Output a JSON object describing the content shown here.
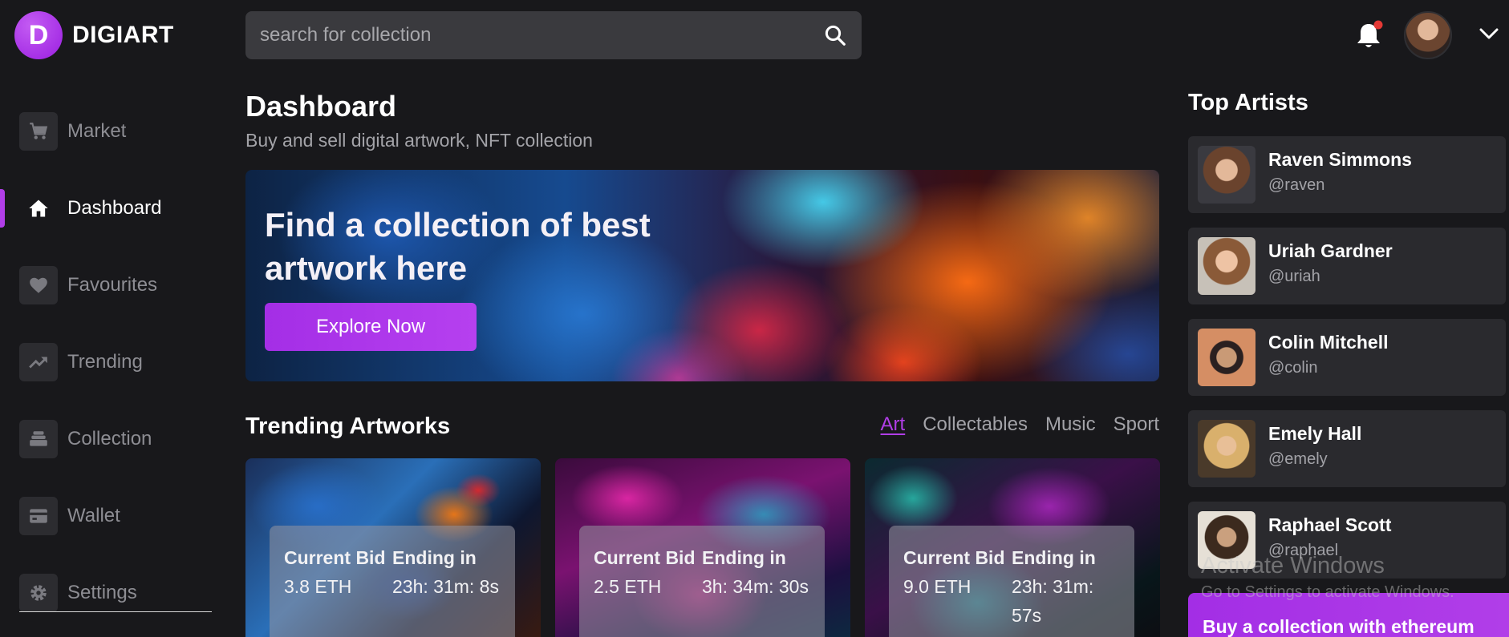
{
  "brand": {
    "logo_letter": "D",
    "name": "DIGIART"
  },
  "header": {
    "search_placeholder": "search for collection",
    "icons": [
      "search-icon",
      "bell-icon",
      "avatar",
      "chevron-down-icon"
    ],
    "notification_dot_color": "#e53935"
  },
  "sidebar": {
    "items": [
      {
        "label": "Market",
        "icon": "cart-icon",
        "active": false
      },
      {
        "label": "Dashboard",
        "icon": "home-icon",
        "active": true
      },
      {
        "label": "Favourites",
        "icon": "heart-icon",
        "active": false
      },
      {
        "label": "Trending",
        "icon": "trending-icon",
        "active": false
      },
      {
        "label": "Collection",
        "icon": "stack-icon",
        "active": false
      },
      {
        "label": "Wallet",
        "icon": "wallet-icon",
        "active": false
      },
      {
        "label": "Settings",
        "icon": "gear-icon",
        "active": false
      }
    ]
  },
  "main": {
    "title": "Dashboard",
    "subtitle": "Buy and sell digital artwork, NFT collection",
    "banner": {
      "title": "Find a collection of best artwork here",
      "button": "Explore Now"
    },
    "trending": {
      "title": "Trending Artworks",
      "filters": [
        "Art",
        "Collectables",
        "Music",
        "Sport"
      ],
      "active_filter": "Art",
      "cards": [
        {
          "bid_label": "Current Bid",
          "bid": "3.8 ETH",
          "ending_label": "Ending in",
          "ending": "23h: 31m: 8s"
        },
        {
          "bid_label": "Current Bid",
          "bid": "2.5 ETH",
          "ending_label": "Ending in",
          "ending": "3h: 34m: 30s"
        },
        {
          "bid_label": "Current Bid",
          "bid": "9.0 ETH",
          "ending_label": "Ending in",
          "ending": "23h: 31m: 57s"
        }
      ]
    }
  },
  "top_artists": {
    "title": "Top Artists",
    "artists": [
      {
        "name": "Raven Simmons",
        "handle": "@raven"
      },
      {
        "name": "Uriah Gardner",
        "handle": "@uriah"
      },
      {
        "name": "Colin Mitchell",
        "handle": "@colin"
      },
      {
        "name": "Emely Hall",
        "handle": "@emely"
      },
      {
        "name": "Raphael Scott",
        "handle": "@raphael"
      }
    ],
    "cta": "Buy a collection with ethereum"
  },
  "overlay": {
    "line1": "Activate Windows",
    "line2": "Go to Settings to activate Windows."
  },
  "colors": {
    "accent": "#b13ee8",
    "background": "#18181b",
    "panel": "#2a2a2e"
  }
}
